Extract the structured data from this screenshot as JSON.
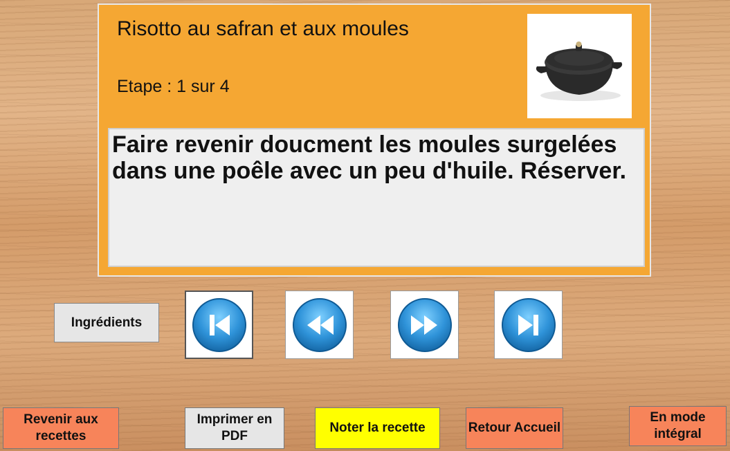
{
  "recipe": {
    "title": "Risotto au safran et aux moules",
    "step_text": "Etape : 1 sur 4",
    "instruction": "Faire revenir doucment les moules surgelées dans une poêle avec un peu d'huile. Réserver.",
    "image_icon": "cast-iron-pot-image"
  },
  "controls": {
    "ingredients_label": "Ingrédients",
    "nav": [
      {
        "name": "first-step",
        "icon": "skip-to-start-icon"
      },
      {
        "name": "previous-step",
        "icon": "rewind-icon"
      },
      {
        "name": "next-step",
        "icon": "fast-forward-icon"
      },
      {
        "name": "last-step",
        "icon": "skip-to-end-icon"
      }
    ]
  },
  "footer": {
    "back_label": "Revenir aux recettes",
    "pdf_label": "Imprimer en PDF",
    "rate_label": "Noter la recette",
    "home_label": "Retour Accueil",
    "full_label": "En mode intégral"
  },
  "colors": {
    "card_bg": "#f5a733",
    "orange_button": "#f7845a",
    "yellow_button": "#ffff00",
    "grey_button": "#e6e6e6",
    "nav_blue": "#2f93d9"
  }
}
